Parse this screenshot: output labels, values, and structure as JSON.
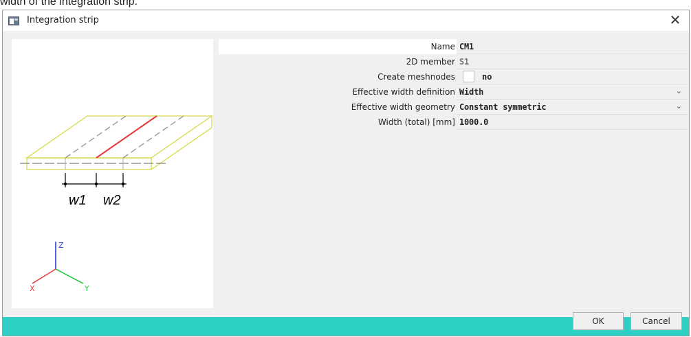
{
  "background": {
    "caption": "width of the integration strip."
  },
  "window": {
    "title": "Integration strip",
    "close_glyph": "✕"
  },
  "preview": {
    "width_labels": [
      "w1",
      "w2"
    ],
    "axes": {
      "x": "X",
      "y": "Y",
      "z": "Z"
    }
  },
  "properties": [
    {
      "label": "Name",
      "value": "CM1"
    },
    {
      "label": "2D member",
      "value": "S1"
    },
    {
      "label": "Create meshnodes",
      "value": "no",
      "checked": false
    },
    {
      "label": "Effective width definition",
      "value": "Width",
      "dropdown": true
    },
    {
      "label": "Effective width geometry",
      "value": "Constant symmetric",
      "dropdown": true
    },
    {
      "label": "Width (total) [mm]",
      "value": "1000.0"
    }
  ],
  "buttons": {
    "ok": "OK",
    "cancel": "Cancel"
  },
  "colors": {
    "accent_bar": "#2ecfc5",
    "strip_line": "#e8393d",
    "plate_outline": "#d8d84a"
  },
  "icons": {
    "app": "window-icon",
    "close": "close-icon",
    "dropdown": "chevron-down-icon"
  }
}
